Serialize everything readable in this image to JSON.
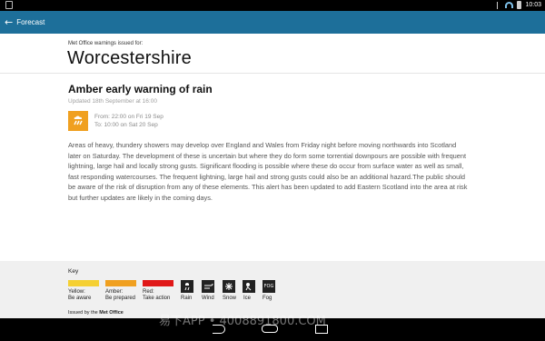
{
  "status_bar": {
    "time": "10:03"
  },
  "app_bar": {
    "title": "Forecast"
  },
  "header": {
    "issued_for": "Met Office warnings issued for:",
    "region": "Worcestershire"
  },
  "warning": {
    "title": "Amber early warning of rain",
    "updated": "Updated 18th September at 16:00",
    "from": "From: 22:00 on Fri 19 Sep",
    "to": "To: 10:00 on Sat 20 Sep",
    "description": "Areas of heavy, thundery showers may develop over England and Wales from Friday night before moving northwards into Scotland later on Saturday. The development of these is uncertain but where they do form some torrential downpours are possible with frequent lightning, large hail and locally strong gusts. Significant flooding is possible where these do occur from surface water as well as small, fast responding watercourses. The frequent lightning, large hail and strong gusts could also be an additional hazard.The public should be aware of the risk of disruption from any of these elements. This alert has been updated to add Eastern Scotland into the area at risk but further updates are likely in the coming days.",
    "icon": "rain-warning-icon",
    "color": "#f0a020"
  },
  "key": {
    "title": "Key",
    "levels": [
      {
        "name": "Yellow:",
        "meaning": "Be aware",
        "color": "#f5d033"
      },
      {
        "name": "Amber:",
        "meaning": "Be prepared",
        "color": "#f0a020"
      },
      {
        "name": "Red:",
        "meaning": "Take action",
        "color": "#e01818"
      }
    ],
    "icons": [
      {
        "label": "Rain",
        "icon": "rain-icon"
      },
      {
        "label": "Wind",
        "icon": "wind-icon"
      },
      {
        "label": "Snow",
        "icon": "snow-icon"
      },
      {
        "label": "Ice",
        "icon": "ice-icon"
      },
      {
        "label": "Fog",
        "icon": "fog-icon",
        "text": "FOG"
      }
    ],
    "issued_by_prefix": "Issued by the",
    "issued_by_org": "Met Office"
  },
  "watermark": "易下APP • 4008891800.COM"
}
